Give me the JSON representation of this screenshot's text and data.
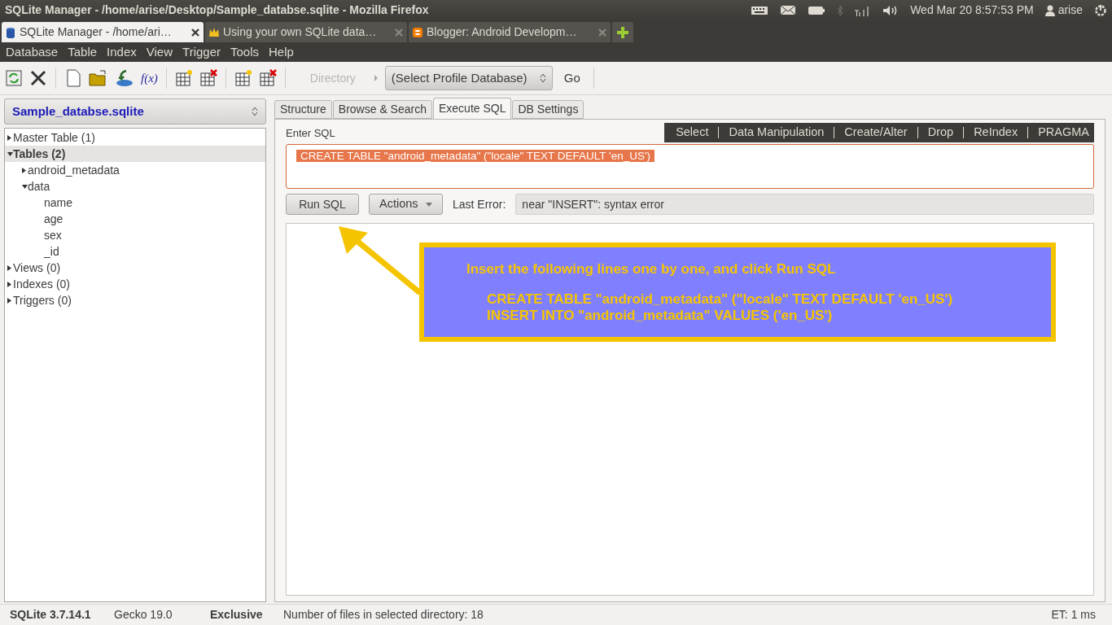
{
  "top_panel": {
    "title": "SQLite Manager - /home/arise/Desktop/Sample_databse.sqlite - Mozilla Firefox",
    "clock": "Wed Mar 20  8:57:53 PM",
    "user": "arise"
  },
  "browser_tabs": [
    {
      "label": "SQLite Manager - /home/ari…",
      "selected": true
    },
    {
      "label": "Using your own SQLite data…",
      "selected": false
    },
    {
      "label": "Blogger: Android Developm…",
      "selected": false
    }
  ],
  "menu": [
    "Database",
    "Table",
    "Index",
    "View",
    "Trigger",
    "Tools",
    "Help"
  ],
  "toolbar": {
    "function_button": "f(x)",
    "directory": "Directory",
    "profile_select": "(Select Profile Database)",
    "go": "Go"
  },
  "database_select": "Sample_databse.sqlite",
  "tree": [
    {
      "label": "Master Table (1)",
      "expanded": false,
      "selected": false
    },
    {
      "label": "Tables (2)",
      "expanded": true,
      "selected": true,
      "children": [
        {
          "label": "android_metadata",
          "expanded": false,
          "selected": false
        },
        {
          "label": "data",
          "expanded": true,
          "selected": false,
          "children": [
            {
              "label": "name",
              "selected": false
            },
            {
              "label": "age",
              "selected": false
            },
            {
              "label": "sex",
              "selected": false
            },
            {
              "label": "_id",
              "selected": false
            }
          ]
        }
      ]
    },
    {
      "label": "Views (0)",
      "expanded": false,
      "selected": false
    },
    {
      "label": "Indexes (0)",
      "expanded": false,
      "selected": false
    },
    {
      "label": "Triggers (0)",
      "expanded": false,
      "selected": false
    }
  ],
  "tabs": [
    {
      "label": "Structure",
      "selected": false
    },
    {
      "label": "Browse & Search",
      "selected": false
    },
    {
      "label": "Execute SQL",
      "selected": true
    },
    {
      "label": "DB Settings",
      "selected": false
    }
  ],
  "sql_panel": {
    "label": "Enter SQL",
    "categories": [
      "Select",
      "Data Manipulation",
      "Create/Alter",
      "Drop",
      "ReIndex",
      "PRAGMA"
    ],
    "query": "CREATE TABLE \"android_metadata\" (\"locale\" TEXT DEFAULT 'en_US')",
    "run_button": "Run SQL",
    "actions_button": "Actions",
    "last_error_label": "Last Error:",
    "last_error": "near \"INSERT\": syntax error"
  },
  "annotation": {
    "heading": "Insert the following lines one by one, and click Run SQL",
    "lines": [
      "CREATE TABLE \"android_metadata\" (\"locale\" TEXT DEFAULT 'en_US')",
      "INSERT INTO \"android_metadata\" VALUES ('en_US')"
    ]
  },
  "status_bar": [
    "SQLite 3.7.14.1",
    "Gecko 19.0",
    "Exclusive",
    "Number of files in selected directory: 18",
    "ET: 1 ms"
  ]
}
